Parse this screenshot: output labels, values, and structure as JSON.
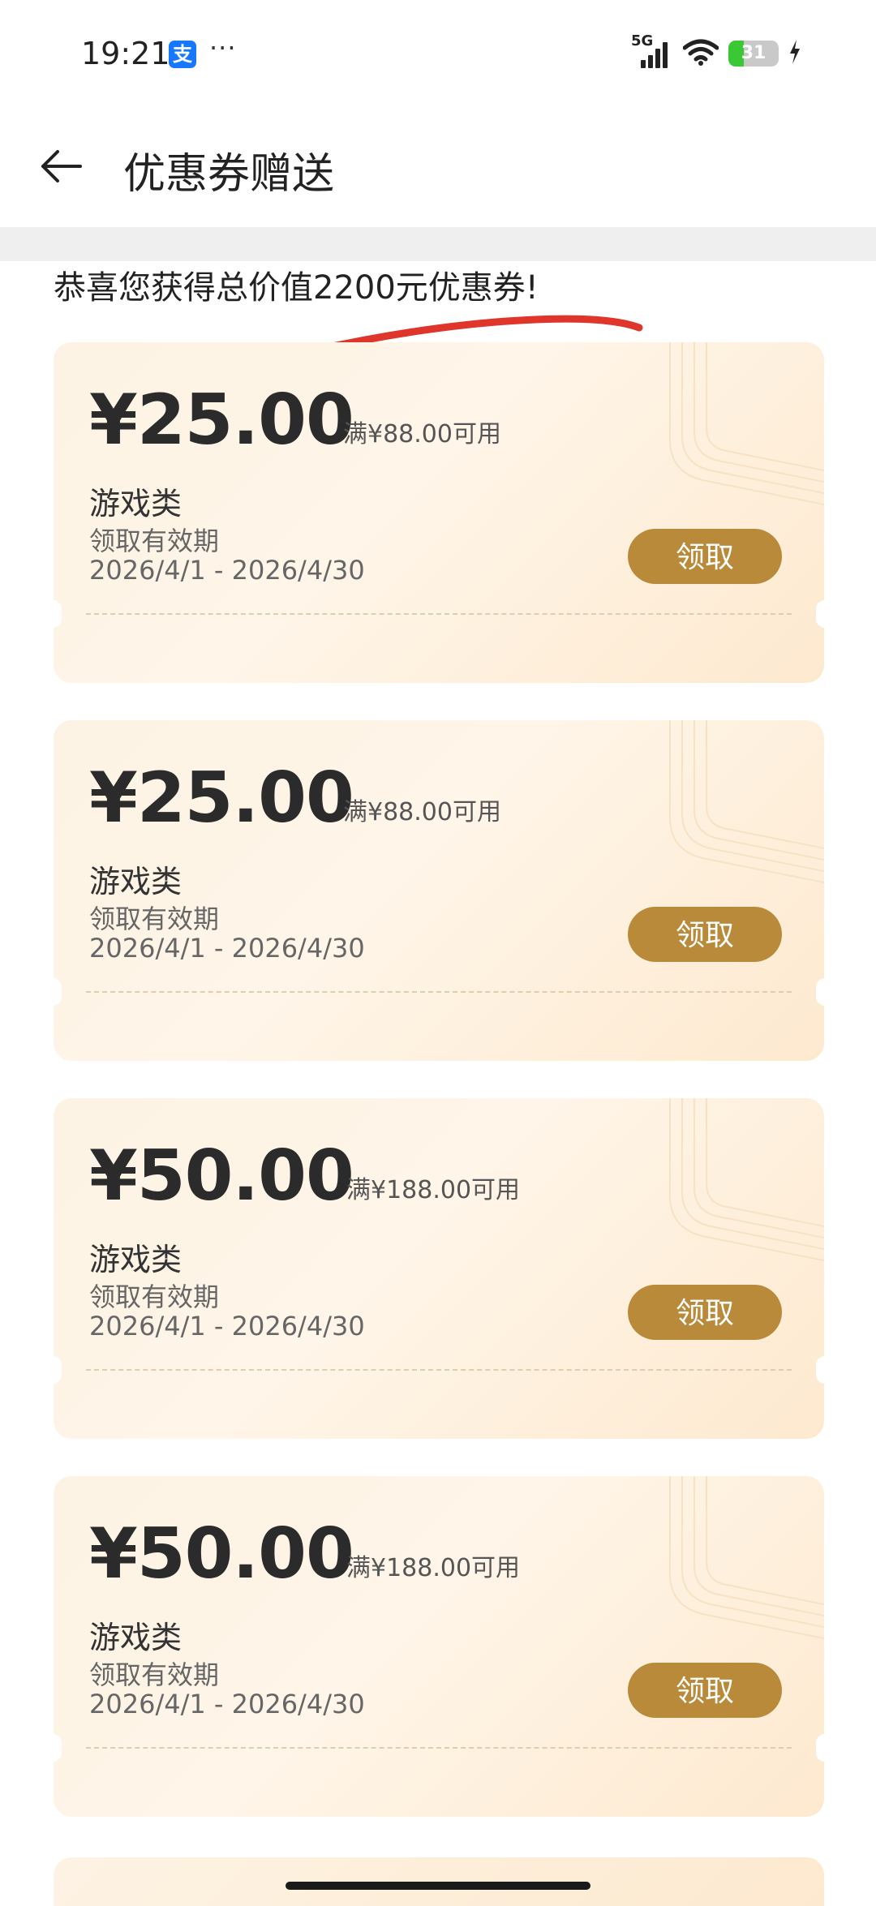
{
  "status_bar": {
    "time": "19:21",
    "app_badge_glyph": "支",
    "more_glyph": "···",
    "network_label": "5G",
    "battery_level": "31",
    "battery_percent": 31
  },
  "header": {
    "title": "优惠券赠送"
  },
  "congrats": {
    "text": "恭喜您获得总价值2200元优惠券!"
  },
  "coupons": [
    {
      "amount": "¥25.00",
      "condition": "满¥88.00可用",
      "category": "游戏类",
      "validity_label": "领取有效期",
      "validity_range": "2026/4/1 - 2026/4/30",
      "claim_label": "领取"
    },
    {
      "amount": "¥25.00",
      "condition": "满¥88.00可用",
      "category": "游戏类",
      "validity_label": "领取有效期",
      "validity_range": "2026/4/1 - 2026/4/30",
      "claim_label": "领取"
    },
    {
      "amount": "¥50.00",
      "condition": "满¥188.00可用",
      "category": "游戏类",
      "validity_label": "领取有效期",
      "validity_range": "2026/4/1 - 2026/4/30",
      "claim_label": "领取"
    },
    {
      "amount": "¥50.00",
      "condition": "满¥188.00可用",
      "category": "游戏类",
      "validity_label": "领取有效期",
      "validity_range": "2026/4/1 - 2026/4/30",
      "claim_label": "领取"
    }
  ],
  "colors": {
    "claim_button": "#b98a3a",
    "card_bg": "#fdf3e4",
    "annotation_stroke": "#e0352b",
    "alipay_blue": "#1677ff",
    "battery_green": "#3ac934"
  },
  "icons": {
    "back": "arrow-left-icon",
    "app_badge": "alipay-icon",
    "signal": "signal-icon",
    "wifi": "wifi-icon",
    "charging": "charging-bolt-icon"
  }
}
